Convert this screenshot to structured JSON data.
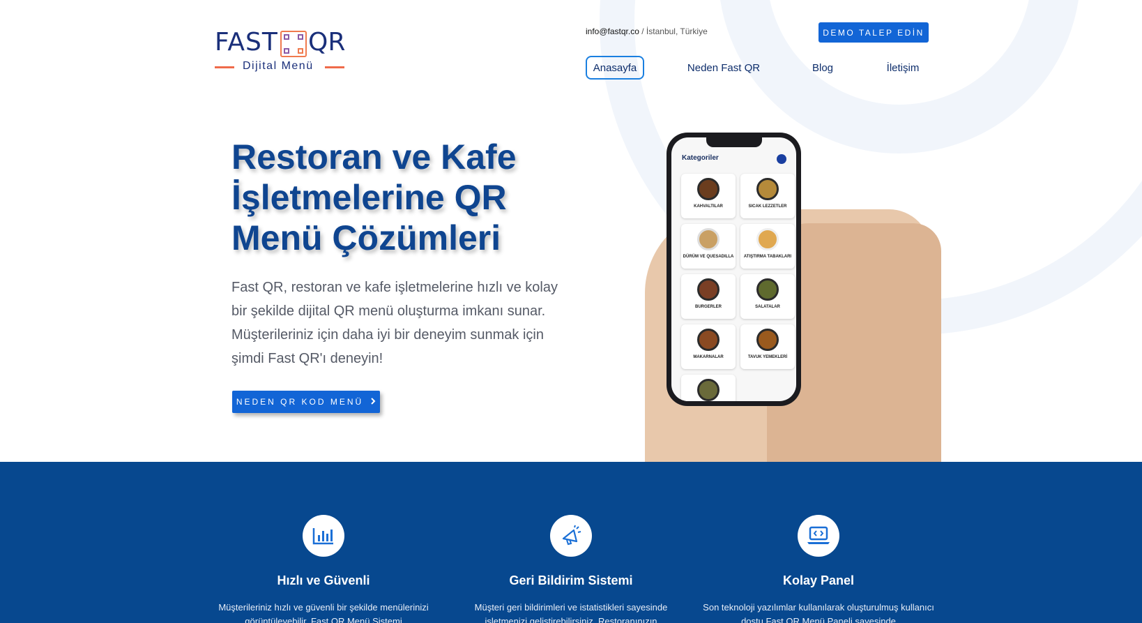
{
  "brand": {
    "logo_word_1": "FAST",
    "logo_word_2": "QR",
    "logo_sub": "Dijital Menü",
    "accent": "#1265d6",
    "navy": "#07488f",
    "title_color": "#0f4590",
    "orange": "#ef6b4a"
  },
  "topbar": {
    "email": "info@fastqr.co",
    "separator": "/",
    "location": "İstanbul, Türkiye",
    "demo_button": "DEMO TALEP EDİN"
  },
  "nav": {
    "items": [
      "Anasayfa",
      "Neden Fast QR",
      "Blog",
      "İletişim"
    ],
    "active": "Anasayfa"
  },
  "hero": {
    "title": "Restoran ve Kafe İşletmelerine QR Menü Çözümleri",
    "text": "Fast QR, restoran ve kafe işletmelerine hızlı ve kolay bir şekilde dijital QR menü oluşturma imkanı sunar. Müşterileriniz için daha iyi bir deneyim sunmak için şimdi Fast QR'ı deneyin!",
    "button": "NEDEN QR KOD MENÜ",
    "button_icon": "chevron-right-icon"
  },
  "phone": {
    "title": "Kategoriler",
    "categories": [
      "KAHVALTILAR",
      "SICAK LEZZETLER",
      "DÜRÜM VE QUESADILLA",
      "ATIŞTIRMA TABAKLARI",
      "BURGERLER",
      "SALATALAR",
      "MAKARNALAR",
      "TAVUK YEMEKLERİ",
      ""
    ]
  },
  "features": [
    {
      "icon": "chart-icon",
      "title": "Hızlı ve Güvenli",
      "text": "Müşterileriniz hızlı ve güvenli bir şekilde menülerinizi görüntüleyebilir. Fast QR Menü Sistemi"
    },
    {
      "icon": "megaphone-icon",
      "title": "Geri Bildirim Sistemi",
      "text": "Müşteri geri bildirimleri ve istatistikleri sayesinde işletmenizi geliştirebilirsiniz. Restoranınızın"
    },
    {
      "icon": "laptop-code-icon",
      "title": "Kolay Panel",
      "text": "Son teknoloji yazılımlar kullanılarak oluşturulmuş kullanıcı dostu Fast QR Menü Paneli sayesinde"
    }
  ]
}
